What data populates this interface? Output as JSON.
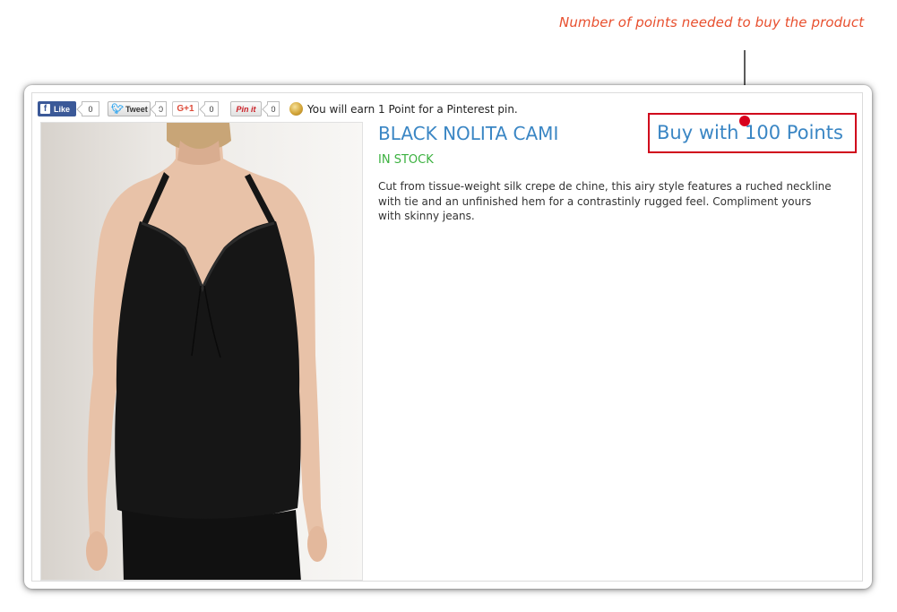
{
  "annotation": {
    "text": "Number of points needed to buy the product"
  },
  "social": {
    "facebook_label": "Like",
    "facebook_icon": "f",
    "facebook_count": "0",
    "twitter_label": "Tweet",
    "twitter_count": "0",
    "gplus_label": "G+1",
    "gplus_count": "0",
    "pinterest_label": "Pin it",
    "pinterest_count": "0",
    "earn_text": "You will earn 1 Point for a Pinterest pin."
  },
  "product": {
    "title": "BLACK NOLITA CAMI",
    "stock": "IN STOCK",
    "description": "Cut from tissue-weight silk crepe de chine, this airy style features a ruched neckline with tie and an unfinished hem for a contrastinly rugged feel. Compliment yours with skinny jeans.",
    "buy_label": "Buy with 100 Points"
  },
  "colors": {
    "annotation": "#e8502f",
    "title": "#3a86c4",
    "stock": "#3bb13f",
    "highlight_border": "#d0021b",
    "facebook": "#3b5998",
    "pinterest": "#cb2027"
  }
}
